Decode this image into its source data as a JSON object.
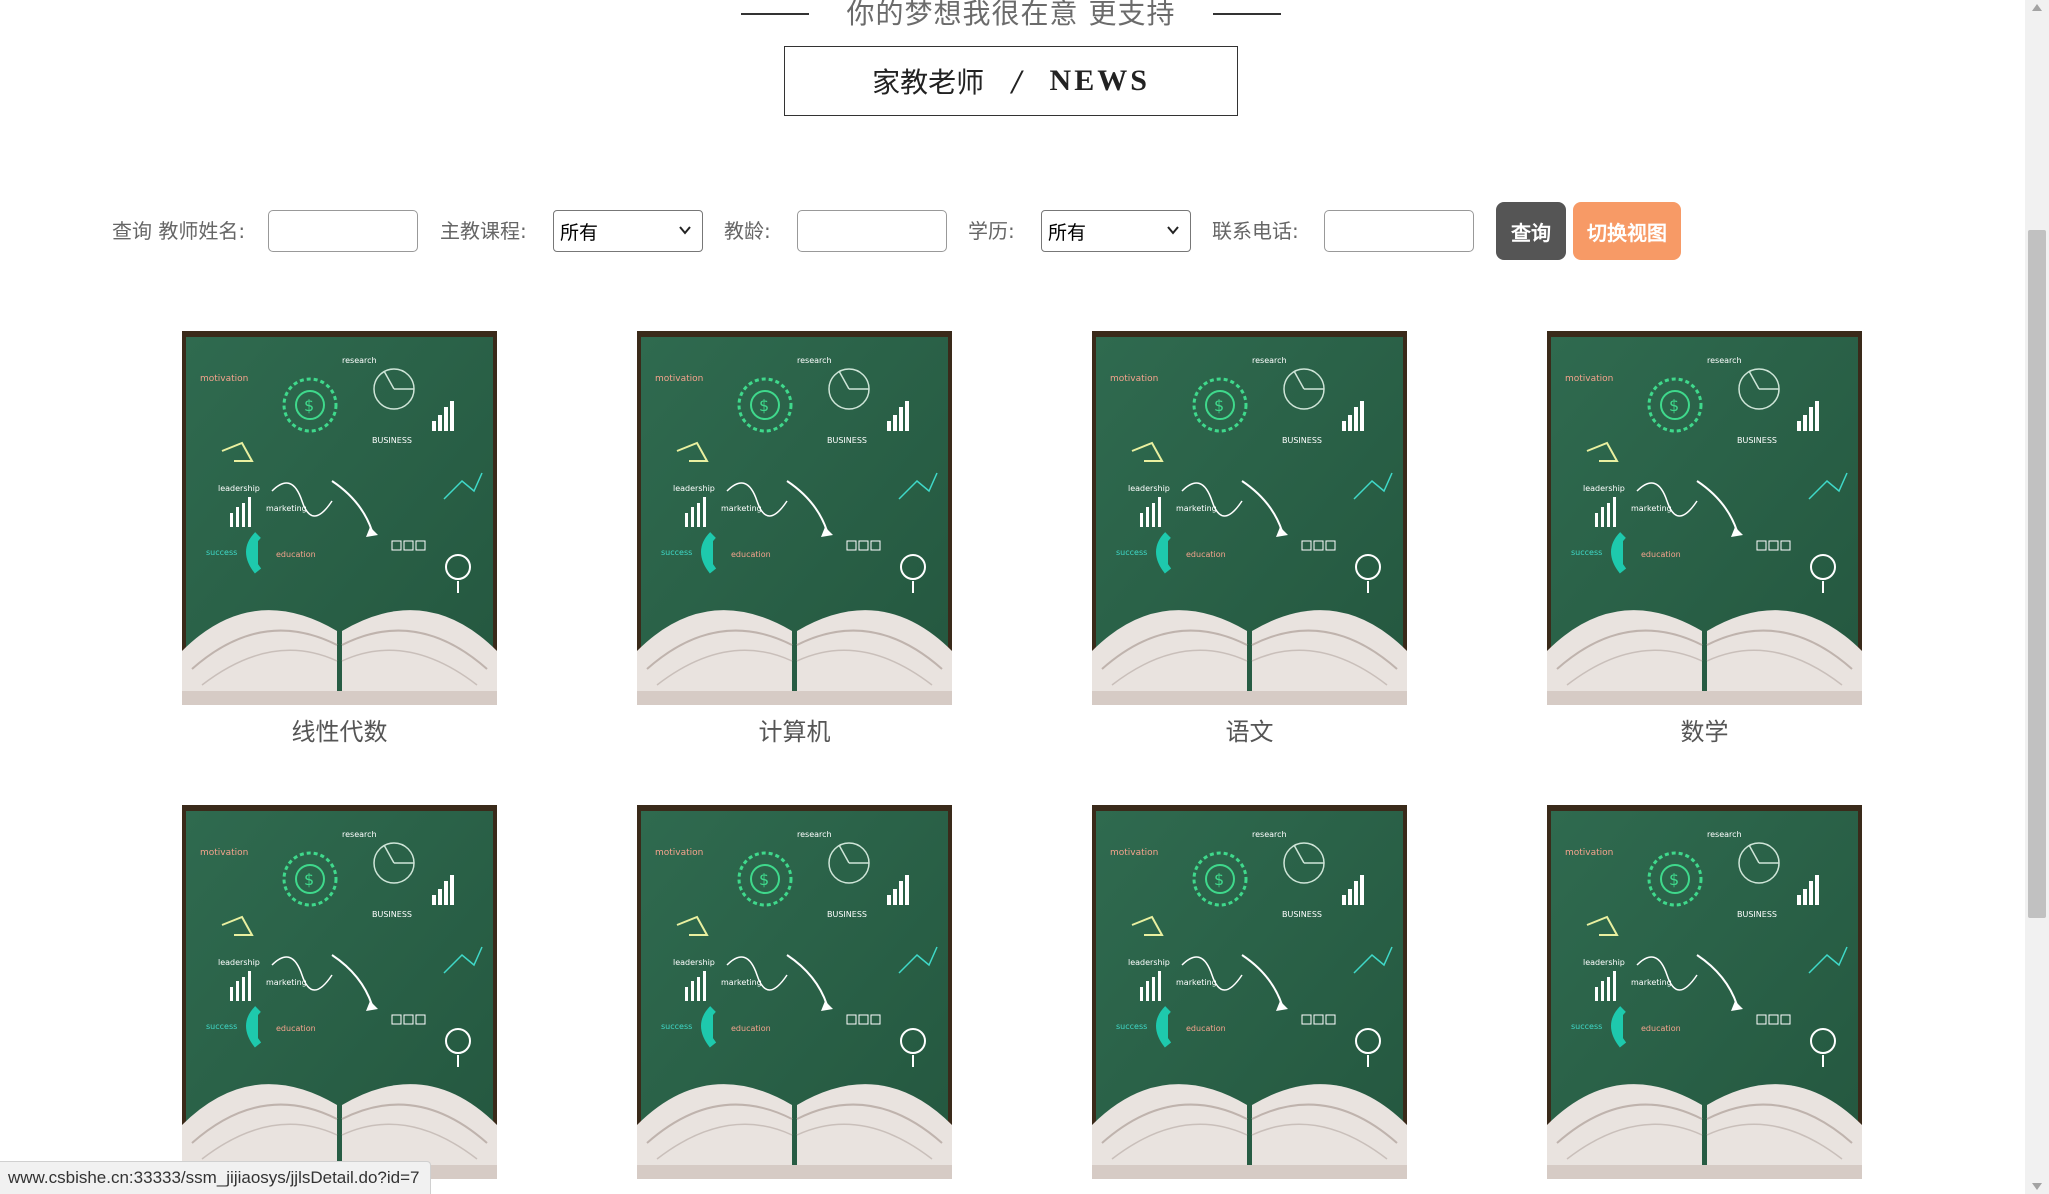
{
  "slogan": {
    "text": "你的梦想我很在意 更支持"
  },
  "title_box": {
    "cn": "家教老师",
    "separator": "/",
    "en": "NEWS"
  },
  "search": {
    "teacher_name_label": "查询 教师姓名:",
    "teacher_name_value": "",
    "course_label": "主教课程:",
    "course_selected": "所有",
    "years_label": "教龄:",
    "years_value": "",
    "education_label": "学历:",
    "education_selected": "所有",
    "phone_label": "联系电话:",
    "phone_value": "",
    "query_button": "查询",
    "switch_view_button": "切换视图"
  },
  "cards": [
    {
      "name": "线性代数"
    },
    {
      "name": "计算机"
    },
    {
      "name": "语文"
    },
    {
      "name": "数学"
    },
    {
      "name": ""
    },
    {
      "name": ""
    },
    {
      "name": ""
    },
    {
      "name": ""
    }
  ],
  "status_bar": {
    "url": "www.csbishe.cn:33333/ssm_jijiaosys/jjlsDetail.do?id=7"
  },
  "colors": {
    "query_button": "#555555",
    "switch_button": "#f79a66",
    "chalkboard": "#2b6149"
  }
}
